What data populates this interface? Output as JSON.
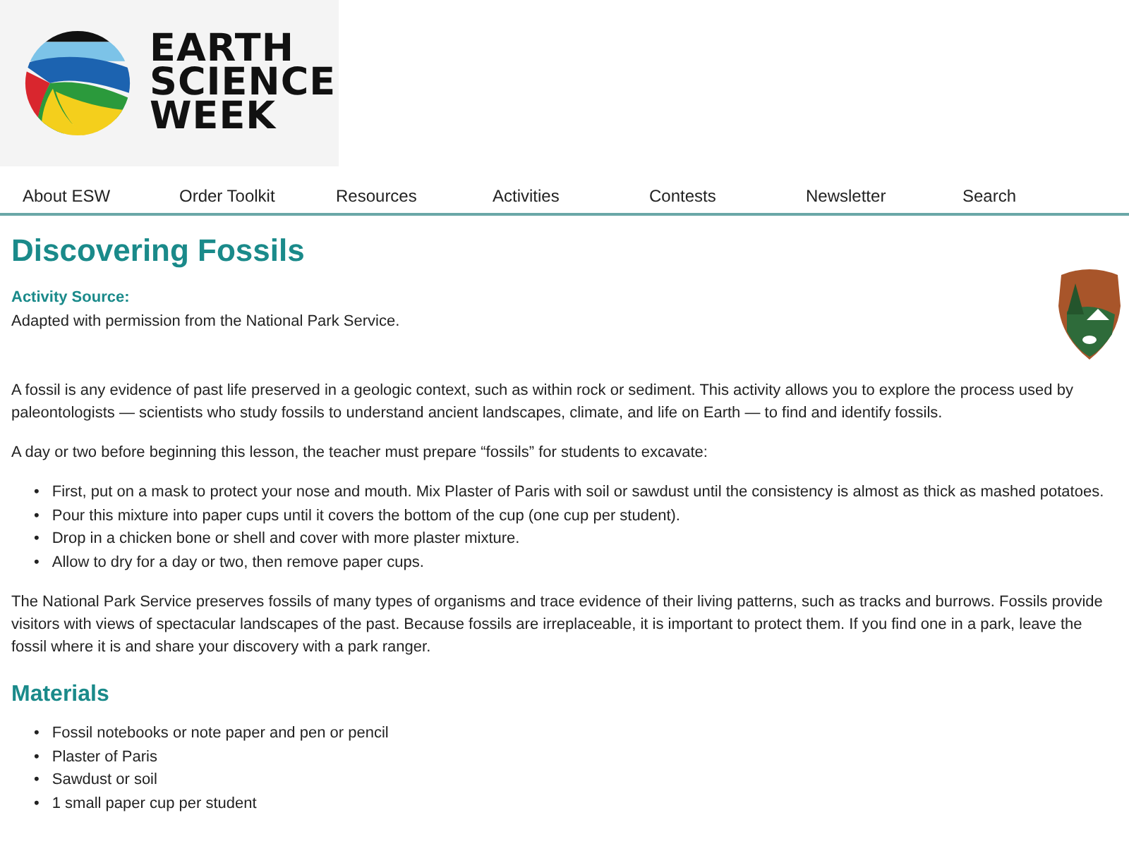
{
  "logo": {
    "lines": [
      "EARTH",
      "SCIENCE",
      "WEEK"
    ]
  },
  "nav": [
    {
      "label": "About ESW"
    },
    {
      "label": "Order Toolkit"
    },
    {
      "label": "Resources"
    },
    {
      "label": "Activities"
    },
    {
      "label": "Contests"
    },
    {
      "label": "Newsletter"
    },
    {
      "label": "Search"
    }
  ],
  "title": "Discovering Fossils",
  "bullet": "•",
  "source": {
    "label": "Activity Source:",
    "text": "Adapted with permission from the National Park Service."
  },
  "intro": "A fossil is any evidence of past life preserved in a geologic context, such as within rock or sediment. This activity allows you to explore the process used by paleontologists — scientists who study fossils to understand ancient landscapes, climate, and life on Earth — to find and identify fossils.",
  "prep": "A day or two before beginning this lesson, the teacher must prepare “fossils” for students to excavate:",
  "steps": [
    "First, put on a mask to protect your nose and mouth. Mix Plaster of Paris with soil or sawdust until the consistency is almost as thick as mashed potatoes.",
    "Pour this mixture into paper cups until it covers the bottom of the cup (one cup per student).",
    "Drop in a chicken bone or shell and cover with more plaster mixture.",
    "Allow to dry for a day or two, then remove paper cups."
  ],
  "closing": "The National Park Service preserves fossils of many types of organisms and trace evidence of their living patterns, such as tracks and burrows. Fossils provide visitors with views of spectacular landscapes of the past. Because fossils are irreplaceable, it is important to protect them. If you find one in a park, leave the fossil where it is and share your discovery with a park ranger.",
  "materials": {
    "heading": "Materials",
    "items": [
      "Fossil notebooks or note paper and pen or pencil",
      "Plaster of Paris",
      "Sawdust or soil",
      "1 small paper cup per student"
    ]
  }
}
